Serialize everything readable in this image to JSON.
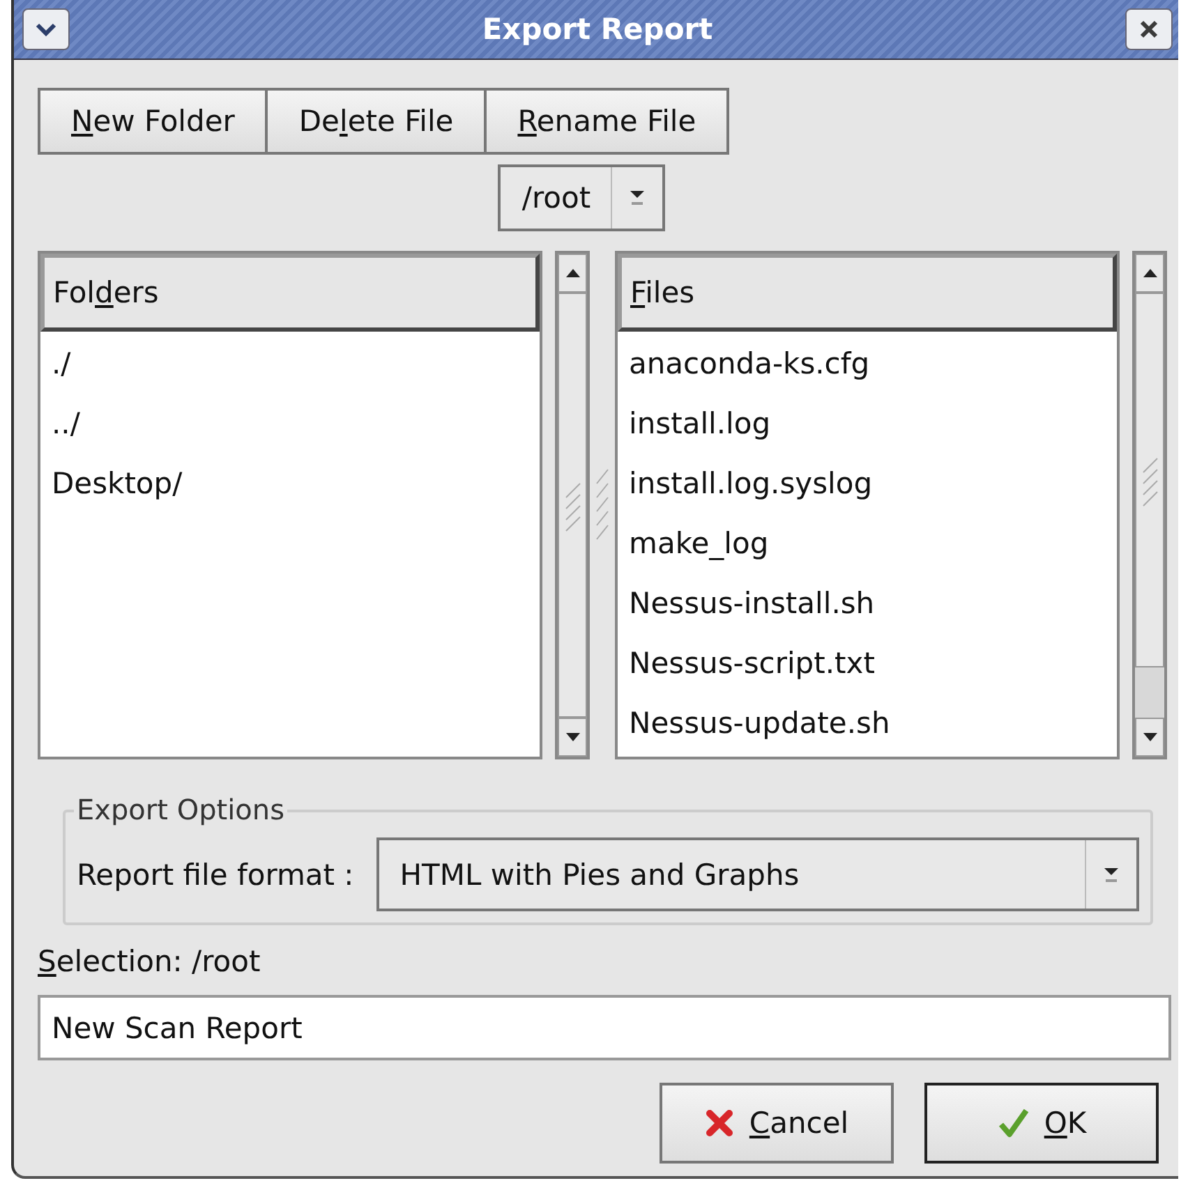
{
  "window": {
    "title": "Export Report"
  },
  "toolbar_buttons": [
    {
      "mnemonic": "N",
      "after": "ew Folder"
    },
    {
      "before": "De",
      "mnemonic": "l",
      "after": "ete File"
    },
    {
      "mnemonic": "R",
      "after": "ename File"
    }
  ],
  "path_combo": {
    "value": "/root"
  },
  "folders": {
    "header": {
      "before": "Fol",
      "mnemonic": "d",
      "after": "ers"
    },
    "items": [
      "./",
      "../",
      "Desktop/"
    ]
  },
  "files": {
    "header": {
      "mnemonic": "F",
      "after": "iles"
    },
    "items": [
      "anaconda-ks.cfg",
      "install.log",
      "install.log.syslog",
      "make_log",
      "Nessus-install.sh",
      "Nessus-script.txt",
      "Nessus-update.sh"
    ]
  },
  "export_options": {
    "title": "Export Options",
    "format_label": "Report file format :",
    "format_value": "HTML with Pies and Graphs"
  },
  "selection": {
    "label": {
      "mnemonic": "S",
      "after": "election: /root"
    },
    "value": "New Scan Report"
  },
  "buttons": [
    {
      "kind": "cancel",
      "mnemonic": "C",
      "after": "ancel"
    },
    {
      "kind": "ok",
      "mnemonic": "O",
      "after": "K"
    }
  ]
}
